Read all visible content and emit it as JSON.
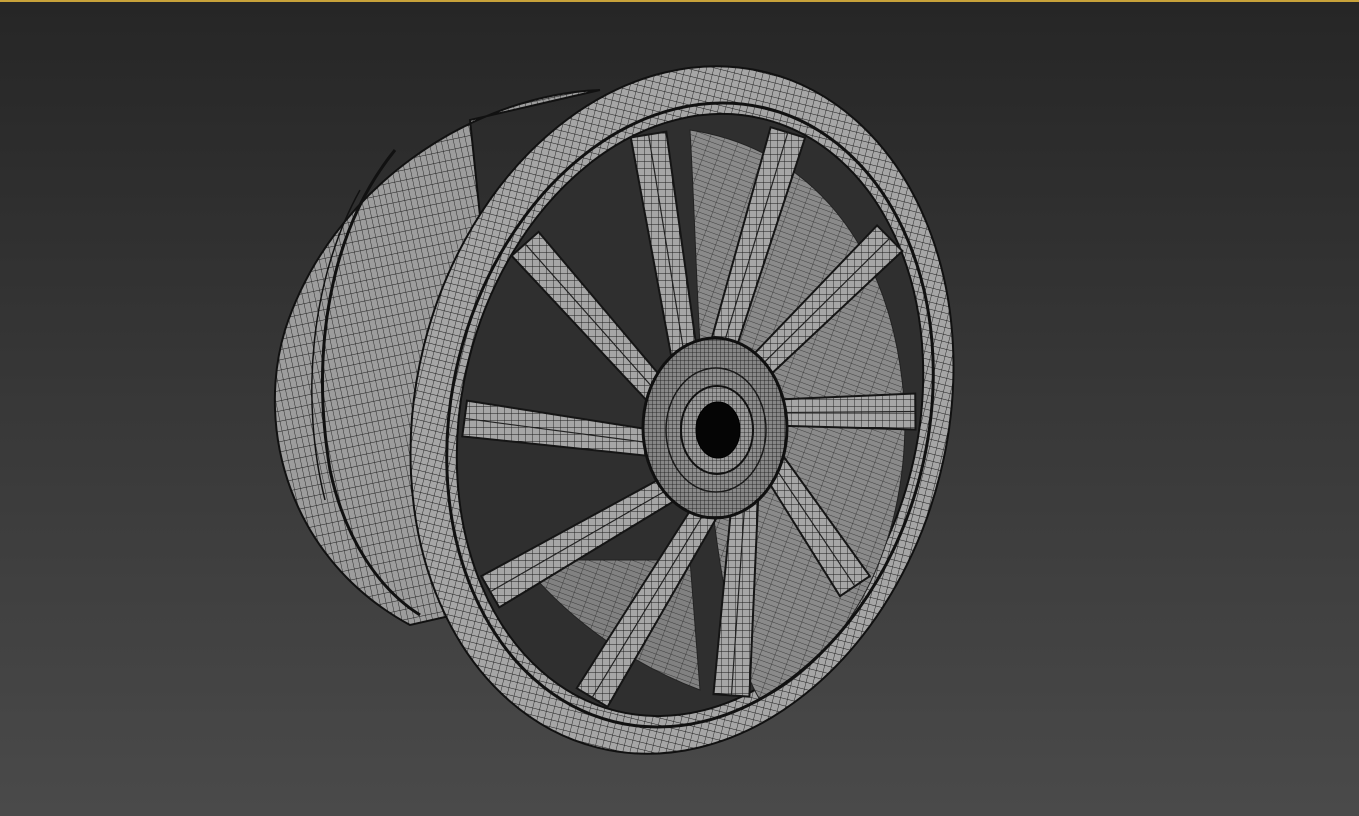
{
  "viewport": {
    "active_border_color": "#c8a23a",
    "background_top": "#262626",
    "background_bottom": "#4a4a4a",
    "shading_mode": "edged-faces-wireframe"
  },
  "model": {
    "object": "wheel-rim",
    "spoke_count": 10,
    "surface_color": "#a9a9a9",
    "edge_color": "#151515",
    "hub_bore_color": "#050505"
  }
}
